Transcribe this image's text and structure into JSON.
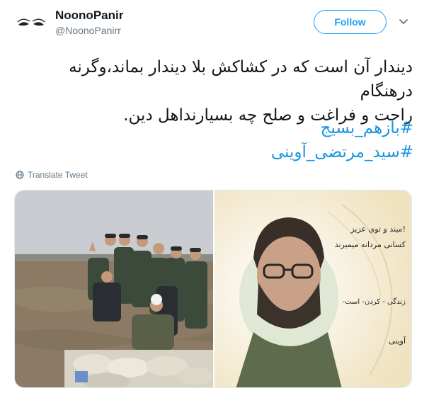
{
  "author": {
    "display_name": "NoonoPanir",
    "handle": "@NoonoPanirr"
  },
  "follow_label": "Follow",
  "tweet": {
    "line1": "دیندار آن است که در کشاکش بلا دیندار بماند،وگرنه درهنگام",
    "line2": "راحت و فراغت و صلح چه بسیارنداهل دین."
  },
  "hashtags": [
    "#بازهم_بسیج",
    "#سید_مرتضی_آوینی"
  ],
  "translate_label": "Translate Tweet",
  "media": {
    "right_poster_lines": [
      "میند و توی عزیز!",
      "کسانی مردانه میمیرند",
      "-زندگی - کردن- است",
      "آوینی"
    ]
  },
  "colors": {
    "accent": "#1da1f2",
    "hashtag": "#1b95e0",
    "secondary": "#657786"
  },
  "icons": [
    "avatar-eyes",
    "chevron-down-icon",
    "globe-icon"
  ]
}
